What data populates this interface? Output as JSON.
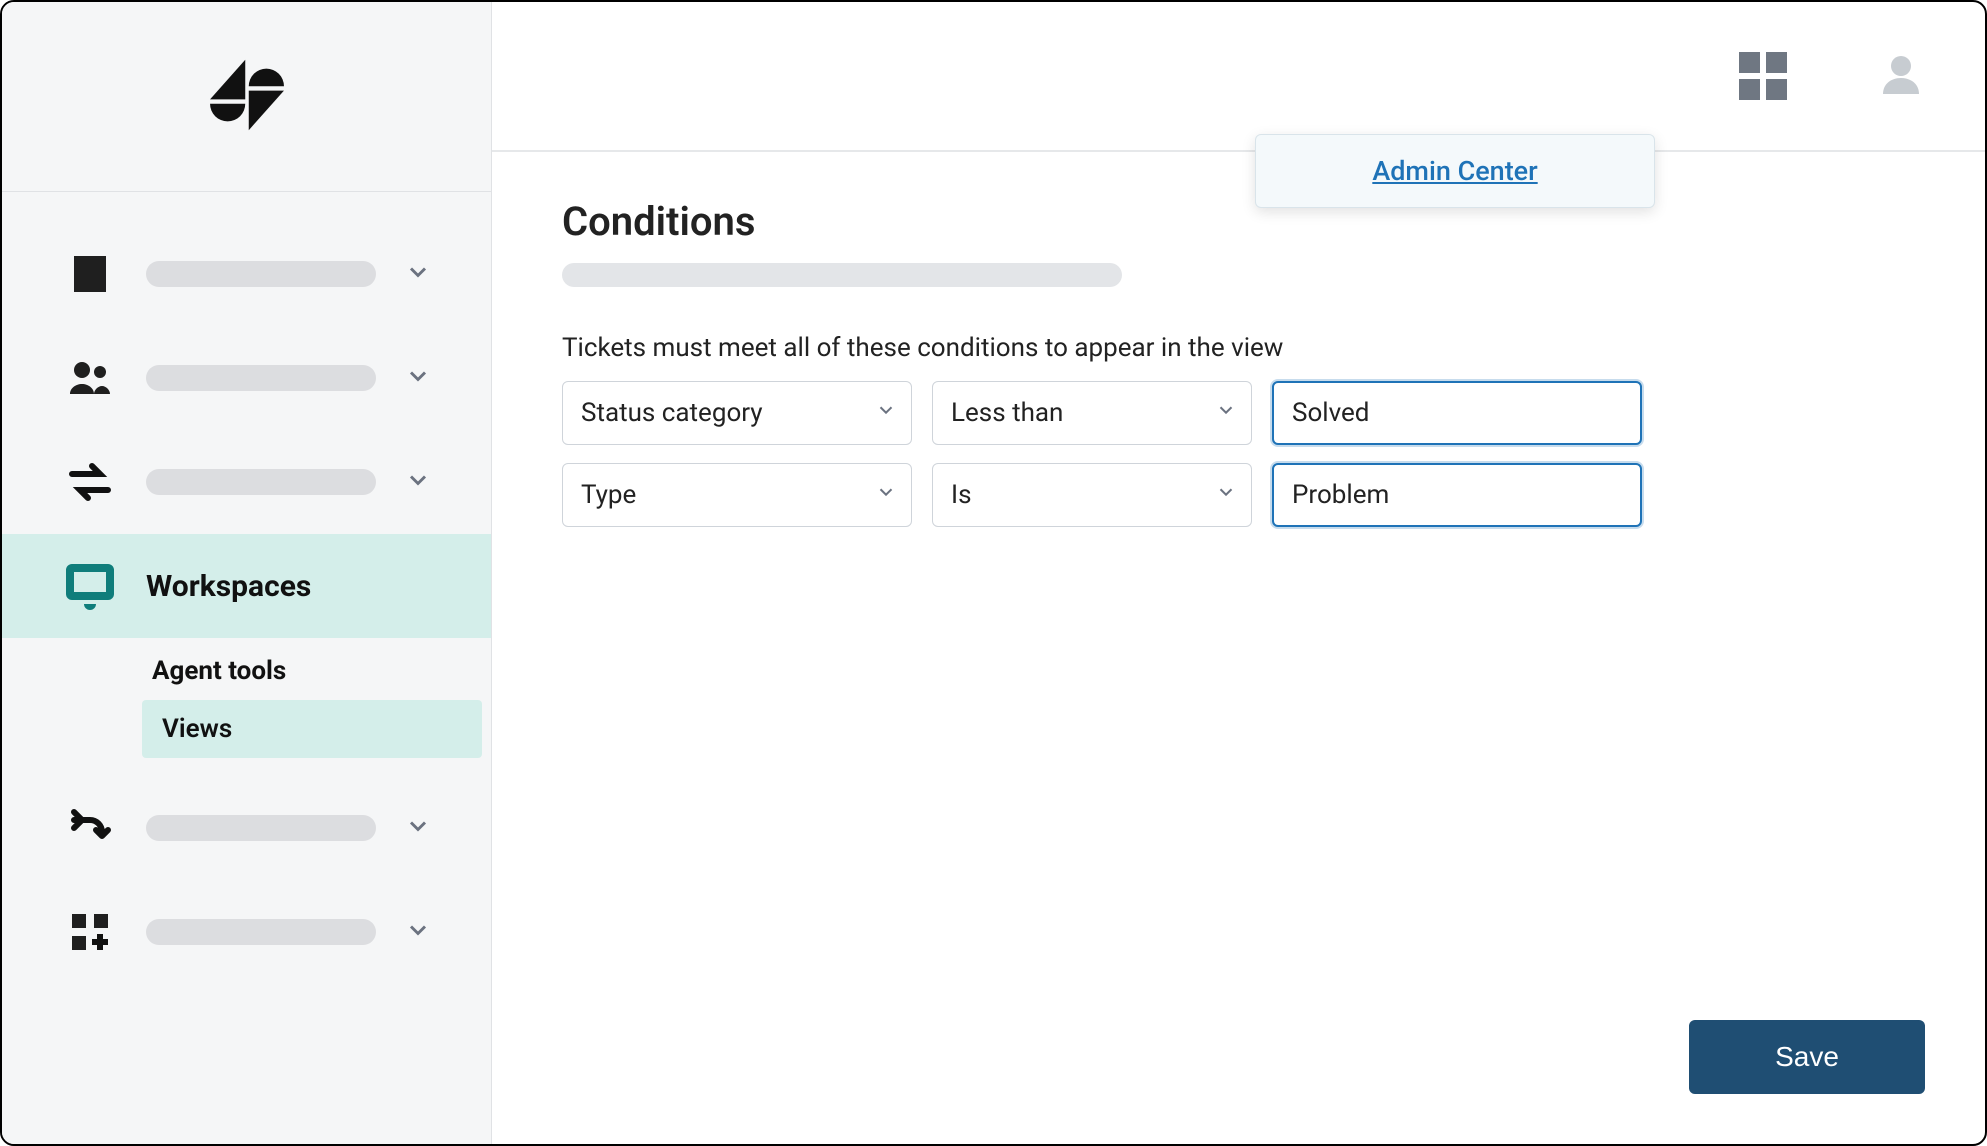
{
  "popover": {
    "link_label": "Admin Center"
  },
  "sidebar": {
    "active_label": "Workspaces",
    "sub": {
      "group": "Agent tools",
      "selected": "Views"
    }
  },
  "main": {
    "title": "Conditions",
    "help": "Tickets must meet all of these conditions to appear in the view",
    "rows": [
      {
        "field": "Status category",
        "op": "Less than",
        "value": "Solved"
      },
      {
        "field": "Type",
        "op": "Is",
        "value": "Problem"
      }
    ],
    "save_label": "Save"
  }
}
